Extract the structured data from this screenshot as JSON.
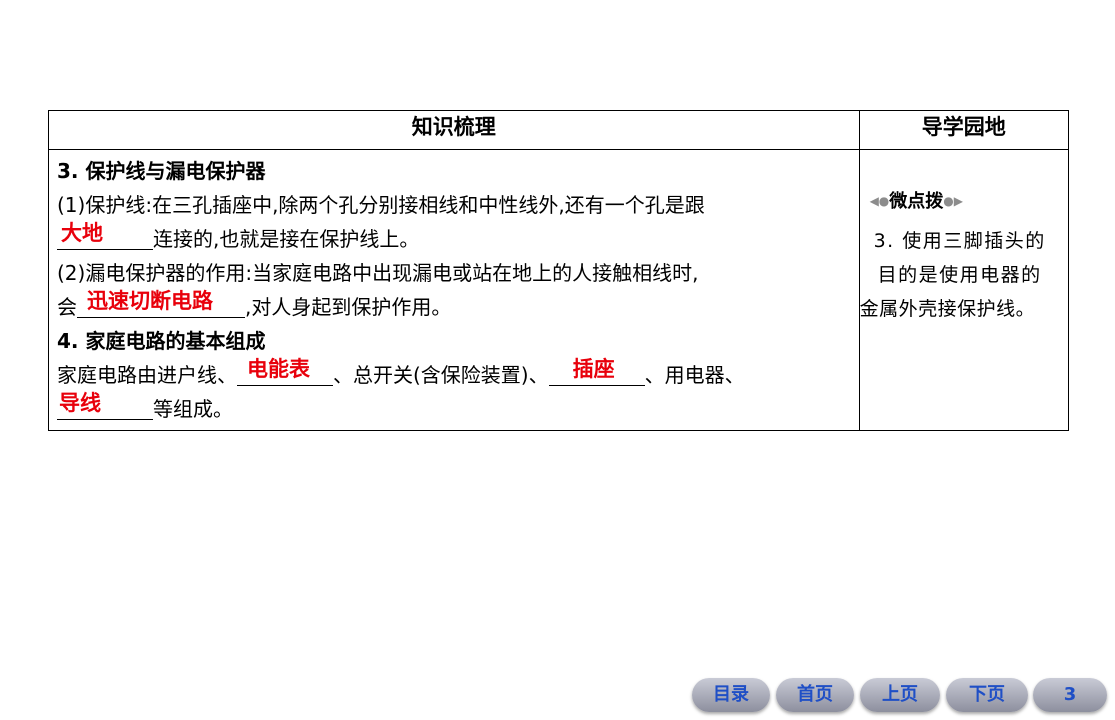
{
  "table": {
    "header_main": "知识梳理",
    "header_side": "导学园地"
  },
  "content": {
    "s3_heading": "3. 保护线与漏电保护器",
    "p1_prefix": "(1)保护线:在三孔插座中,除两个孔分别接相线和中性线外,还有一个孔是跟",
    "p1_answer": "大地",
    "p1_suffix": "连接的,也就是接在保护线上。",
    "p2_text": "(2)漏电保护器的作用:当家庭电路中出现漏电或站在地上的人接触相线时,",
    "p2_prefix": "会",
    "p2_answer": "迅速切断电路",
    "p2_suffix": ",对人身起到保护作用。",
    "s4_heading": "4. 家庭电路的基本组成",
    "p3_text_a": "家庭电路由进户线、",
    "p3_answer_1": "电能表",
    "p3_text_b": "、总开关(含保险装置)、",
    "p3_answer_2": "插座",
    "p3_text_c": "、用电器、",
    "p3_answer_3": "导线",
    "p3_text_d": "等组成。"
  },
  "sidebar": {
    "tip_title": "微点拨",
    "tip_lines": [
      "3. 使用三脚插头的",
      "目的是使用电器的",
      "金属外壳接保护线。"
    ]
  },
  "nav": {
    "toc": "目录",
    "home": "首页",
    "prev": "上页",
    "next": "下页",
    "page": "3"
  },
  "colors": {
    "answer": "#e8000b",
    "nav_text": "#1f4fc6"
  }
}
